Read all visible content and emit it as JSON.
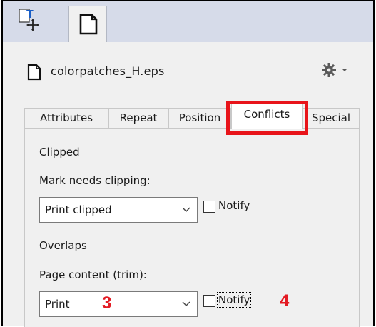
{
  "file": {
    "name": "colorpatches_H.eps"
  },
  "tabs": [
    {
      "label": "Attributes"
    },
    {
      "label": "Repeat"
    },
    {
      "label": "Position"
    },
    {
      "label": "Conflicts"
    },
    {
      "label": "Special"
    }
  ],
  "active_tab": "Conflicts",
  "clipped": {
    "section_label": "Clipped",
    "field_label": "Mark needs clipping:",
    "select_value": "Print clipped",
    "notify_label": "Notify",
    "notify_checked": false
  },
  "overlaps": {
    "section_label": "Overlaps",
    "field_label": "Page content (trim):",
    "select_value": "Print",
    "notify_label": "Notify",
    "notify_checked": false
  },
  "callouts": {
    "select": "3",
    "notify": "4"
  },
  "colors": {
    "highlight": "#e8141a",
    "callout": "#e31b23",
    "toolbar": "#d6dbe9"
  },
  "icons": [
    "text-placement-icon",
    "document-icon",
    "file-icon",
    "gear-icon",
    "chevron-down-icon"
  ]
}
